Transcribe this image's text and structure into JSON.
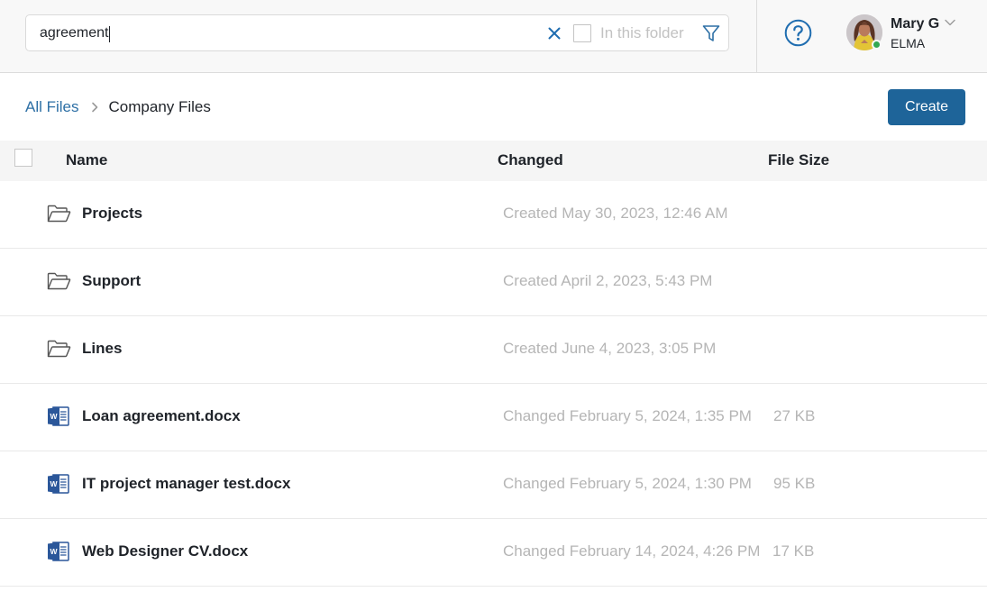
{
  "search": {
    "value": "agreement",
    "clear_label": "×",
    "in_folder_label": "In this folder",
    "in_folder_checked": false
  },
  "user": {
    "name": "Mary G",
    "org": "ELMA",
    "status": "online",
    "status_color": "#33a852"
  },
  "icons": {
    "clear": "close-icon",
    "filter": "filter-icon",
    "help": "help-icon",
    "chevron": "chevron-down-icon",
    "folder": "folder-icon",
    "word": "word-doc-icon"
  },
  "breadcrumb": {
    "root": "All Files",
    "current": "Company Files"
  },
  "toolbar": {
    "create_label": "Create"
  },
  "colors": {
    "accent": "#1e6499",
    "link": "#2d6fa5",
    "muted_text": "#b5b5b5",
    "word_blue": "#2b579a"
  },
  "table": {
    "columns": [
      "Name",
      "Changed",
      "File Size"
    ],
    "rows": [
      {
        "type": "folder",
        "name": "Projects",
        "changed": "Created May 30, 2023, 12:46 AM",
        "size": ""
      },
      {
        "type": "folder",
        "name": "Support",
        "changed": "Created April 2, 2023, 5:43 PM",
        "size": ""
      },
      {
        "type": "folder",
        "name": "Lines",
        "changed": "Created June 4, 2023, 3:05 PM",
        "size": ""
      },
      {
        "type": "docx",
        "name": "Loan agreement.docx",
        "changed": "Changed February 5, 2024, 1:35 PM",
        "size": "27 KB"
      },
      {
        "type": "docx",
        "name": "IT project manager test.docx",
        "changed": "Changed February 5, 2024, 1:30 PM",
        "size": "95 KB"
      },
      {
        "type": "docx",
        "name": "Web Designer CV.docx",
        "changed": "Changed February 14, 2024, 4:26 PM",
        "size": "17 KB"
      }
    ]
  }
}
